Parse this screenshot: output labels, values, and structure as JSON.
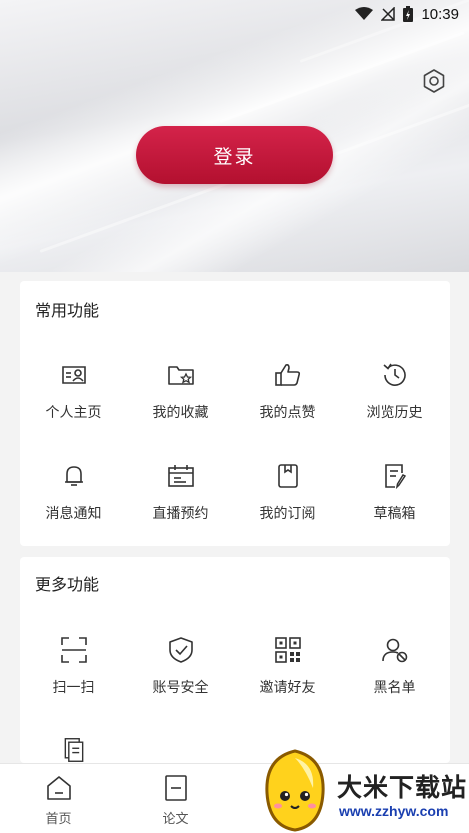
{
  "status_bar": {
    "time": "10:39"
  },
  "login": {
    "label": "登录"
  },
  "common": {
    "title": "常用功能",
    "items": [
      {
        "label": "个人主页",
        "icon": "profile-card-icon"
      },
      {
        "label": "我的收藏",
        "icon": "folder-star-icon"
      },
      {
        "label": "我的点赞",
        "icon": "thumbs-up-icon"
      },
      {
        "label": "浏览历史",
        "icon": "history-clock-icon"
      },
      {
        "label": "消息通知",
        "icon": "bell-icon"
      },
      {
        "label": "直播预约",
        "icon": "calendar-icon"
      },
      {
        "label": "我的订阅",
        "icon": "bookmark-icon"
      },
      {
        "label": "草稿箱",
        "icon": "draft-edit-icon"
      }
    ]
  },
  "more": {
    "title": "更多功能",
    "items": [
      {
        "label": "扫一扫",
        "icon": "scan-icon"
      },
      {
        "label": "账号安全",
        "icon": "shield-check-icon"
      },
      {
        "label": "邀请好友",
        "icon": "qr-code-icon"
      },
      {
        "label": "黑名单",
        "icon": "user-block-icon"
      }
    ]
  },
  "tabbar": {
    "items": [
      {
        "label": "首页",
        "icon": "home-icon"
      },
      {
        "label": "论文",
        "icon": "document-icon"
      }
    ]
  },
  "watermark": {
    "title": "大米下载站",
    "url": "www.zzhyw.com"
  },
  "colors": {
    "accent": "#c41a3c",
    "icon_stroke": "#333333",
    "background": "#f3f3f3"
  }
}
